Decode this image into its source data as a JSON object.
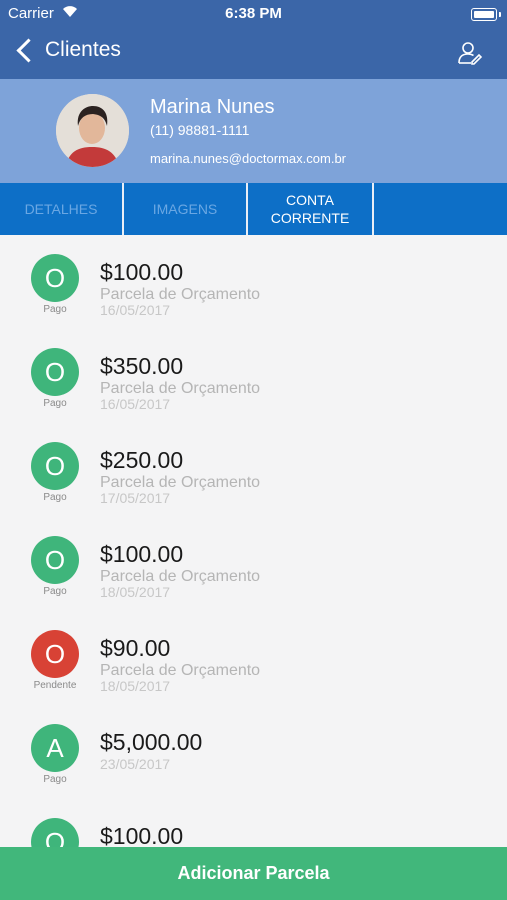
{
  "status_bar": {
    "carrier": "Carrier",
    "time": "6:38 PM"
  },
  "nav": {
    "back_label": "Clientes"
  },
  "profile": {
    "name": "Marina Nunes",
    "phone": "(11) 98881-1111",
    "email": "marina.nunes@doctormax.com.br"
  },
  "tabs": [
    {
      "label": "DETALHES"
    },
    {
      "label": "IMAGENS"
    },
    {
      "label": "CONTA CORRENTE"
    }
  ],
  "items": [
    {
      "letter": "O",
      "status": "Pago",
      "amount": "$100.00",
      "description": "Parcela de Orçamento",
      "date": "16/05/2017",
      "color": "#3fb57b"
    },
    {
      "letter": "O",
      "status": "Pago",
      "amount": "$350.00",
      "description": "Parcela de Orçamento",
      "date": "16/05/2017",
      "color": "#3fb57b"
    },
    {
      "letter": "O",
      "status": "Pago",
      "amount": "$250.00",
      "description": "Parcela de Orçamento",
      "date": "17/05/2017",
      "color": "#3fb57b"
    },
    {
      "letter": "O",
      "status": "Pago",
      "amount": "$100.00",
      "description": "Parcela de Orçamento",
      "date": "18/05/2017",
      "color": "#3fb57b"
    },
    {
      "letter": "O",
      "status": "Pendente",
      "amount": "$90.00",
      "description": "Parcela de Orçamento",
      "date": "18/05/2017",
      "color": "#d84235"
    },
    {
      "letter": "A",
      "status": "Pago",
      "amount": "$5,000.00",
      "description": "",
      "date": "23/05/2017",
      "color": "#3fb57b"
    },
    {
      "letter": "O",
      "status": "",
      "amount": "$100.00",
      "description": "",
      "date": "",
      "color": "#3fb57b"
    }
  ],
  "add_button": {
    "label": "Adicionar Parcela"
  },
  "icons": {
    "back": "chevron-left-icon",
    "user": "user-edit-icon",
    "wifi": "wifi-icon",
    "battery": "battery-icon"
  }
}
